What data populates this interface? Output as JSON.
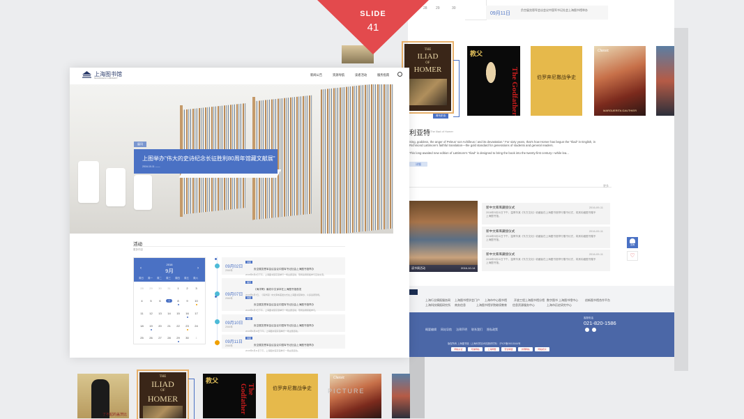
{
  "slide": {
    "label": "SLIDE",
    "number": "41"
  },
  "top_strip": {
    "days": [
      "28",
      "29",
      "30"
    ],
    "event_date": "09月11日",
    "event_tag": "",
    "event_text": "负空展览恩军会议会议中国军书记社会上海图书馆举办"
  },
  "brand": {
    "logo_text": "上海图书馆",
    "logo_sub": "SHANGHAI LIBRARY"
  },
  "nav": {
    "items": [
      "新闻公告",
      "资源导航",
      "读者活动",
      "服务指南"
    ]
  },
  "hero": {
    "tag": "展讯",
    "title": "上图举办\"伟大的史诗纪念长征胜利80周年馆藏文献展\"",
    "date": "2016-10-11 ——"
  },
  "activities": {
    "title": "活动",
    "more": "更多内容",
    "calendar": {
      "year": "2016",
      "month": "9月",
      "prev": "‹",
      "next": "›",
      "weekdays": [
        "周日",
        "周一",
        "周二",
        "周三",
        "周四",
        "周五",
        "周六"
      ],
      "weeks": [
        [
          "28",
          "29",
          "30",
          "31",
          "1",
          "2",
          "3"
        ],
        [
          "4",
          "5",
          "6",
          "7",
          "8",
          "9",
          "10"
        ],
        [
          "11",
          "12",
          "13",
          "14",
          "15",
          "16",
          "17"
        ],
        [
          "18",
          "19",
          "20",
          "21",
          "22",
          "23",
          "24"
        ],
        [
          "25",
          "26",
          "27",
          "28",
          "29",
          "30",
          "1"
        ]
      ]
    },
    "events": [
      {
        "date": "09月02日",
        "year": "2016年",
        "items": [
          {
            "tag": "讲座",
            "title": "负空展览恩军会议会议中国军书记社会上海图书馆举办",
            "desc": "2016年9月2日下午，上海图书馆东馆举行一场主题活动，现场读者积极参与互动交流。"
          }
        ]
      },
      {
        "date": "09月07日",
        "year": "2016年",
        "items": [
          {
            "tag": "展览",
            "title": "《海洋哥》最初中文译本在上海图书馆首发",
            "desc": "2016年9月7日，《海洋哥》中文译本首发仪式在上海图书馆举办，众多读者到场。"
          },
          {
            "tag": "讲座",
            "title": "负空展览恩军会议会议中国军书记社会上海图书馆举办",
            "desc": "2016年9月7日下午，上海图书馆东馆举行一场主题活动，现场读者积极参与。"
          }
        ]
      },
      {
        "date": "09月10日",
        "year": "2016年",
        "items": [
          {
            "tag": "讲座",
            "title": "负空展览恩军会议会议中国军书记社会上海图书馆举办",
            "desc": "2016年9月10日下午，上海图书馆东馆举行一场主题活动。"
          }
        ]
      },
      {
        "date": "09月11日",
        "year": "2016年",
        "items": [
          {
            "tag": "讲座",
            "title": "负空展览恩军会议会议中国军书记社会上海图书馆举办",
            "desc": "2016年9月11日下午，上海图书馆东馆举行一场主题活动。"
          }
        ]
      }
    ]
  },
  "books": {
    "iliad": {
      "line1": "THE",
      "line2": "ILIAD",
      "line3": "OF",
      "line4": "HOMER",
      "badge": "荷马史诗"
    },
    "yellow_title": "伯罗奔尼撒战争史",
    "godfather_title": "The Godfather",
    "godfather_cn": "教父",
    "poster_title": "MARGUERITA GAUTHIER",
    "poster_brand": "Classic",
    "bw_caption": "了不起的盖茨比"
  },
  "detail": {
    "title": "利亚特",
    "subtitle": "The Iliad of Homer",
    "para1": "Sing, goddess, the anger of Peleus' son Achilleus / and its devastation.\" For sixty years, that's how Homer has begun the \"Iliad\" in English, in Richmond Lattimore's faithful translation—the gold standard for generations of students and general readers.",
    "para2": "This long-awaited new edition of Lattimore's \"Iliad\" is designed to bring the book into the twenty-first century—while lea...",
    "more": "详细",
    "rule_more": "更多"
  },
  "news": {
    "image_caption": "读书周活动",
    "image_date": "2016-10-14",
    "cards": [
      {
        "title": "新中文库库藏接仪式",
        "date": "2016-09-11",
        "desc": "2016年9月11日下午，温哥华某《东方文化》收藏者在上海图书馆举行赠书仪式，将其珍藏图书赠予上海图书馆。"
      },
      {
        "title": "新中文库库藏接仪式",
        "date": "2016-09-11",
        "desc": "2016年9月11日下午，温哥华某《东方文化》收藏者在上海图书馆举行赠书仪式，将其珍藏图书赠予上海图书馆。"
      },
      {
        "title": "新中文库库藏接仪式",
        "date": "2016-09-11",
        "desc": "2016年9月11日下午，温哥华某《东方文化》收藏者在上海图书馆举行赠书仪式，将其珍藏图书赠予上海图书馆。"
      }
    ]
  },
  "float": {
    "top": "咨询",
    "heart": "♡"
  },
  "links": {
    "row1": [
      "上海行业情报服务网",
      "上海图书馆学会门户",
      "上海市中心图书馆",
      "开放工程上海图书馆分馆",
      "数字图书 上海图书馆中心",
      "创新图书馆合作平台"
    ],
    "row2": [
      "上海科技情报研究所",
      "商务信息",
      "上海图书馆学院继续教育",
      "信息资源服务中心",
      "上海市历史研究中心"
    ]
  },
  "footer": {
    "nav": [
      "概要编辑",
      "网站导航",
      "法律声明",
      "联系我们",
      "隐私政策"
    ],
    "phone_label": "客服电话",
    "phone": "021-820-1586",
    "copyright": "版权所有 上海图书馆（上海科学技术情报研究所）  沪ICP备05015164号",
    "badges": [
      "网站认证",
      "可信网站",
      "上海网警",
      "安全联盟",
      "文明网站",
      "网站标识"
    ]
  },
  "watermark": "PICTURE",
  "colors": {
    "accent": "#4a71c4",
    "slide_red": "#e34a4d",
    "footer": "#4b67a7",
    "orange": "#f0a000"
  }
}
